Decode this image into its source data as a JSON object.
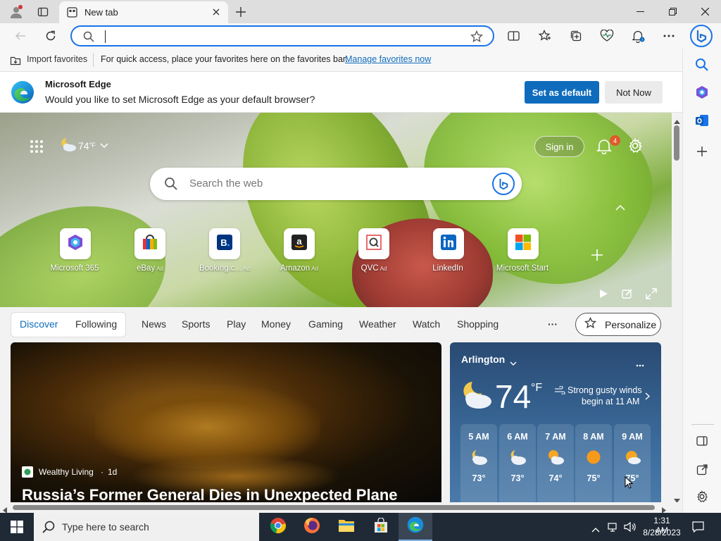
{
  "browser": {
    "tab_title": "New tab",
    "address_value": "",
    "favbar": {
      "import_label": "Import favorites",
      "message": "For quick access, place your favorites here on the favorites bar.",
      "link": "Manage favorites now"
    },
    "notice": {
      "title": "Microsoft Edge",
      "message": "Would you like to set Microsoft Edge as your default browser?",
      "primary_button": "Set as default",
      "secondary_button": "Not Now"
    }
  },
  "newtab": {
    "weather_temp": "74",
    "weather_unit": "°F",
    "sign_in": "Sign in",
    "notification_count": "4",
    "search_placeholder": "Search the web",
    "tiles": [
      {
        "label": "Microsoft 365",
        "ad": ""
      },
      {
        "label": "eBay",
        "ad": "Ad"
      },
      {
        "label": "Booking.c...",
        "ad": "Ad"
      },
      {
        "label": "Amazon",
        "ad": "Ad"
      },
      {
        "label": "QVC",
        "ad": "Ad"
      },
      {
        "label": "LinkedIn",
        "ad": ""
      },
      {
        "label": "Microsoft Start",
        "ad": ""
      }
    ]
  },
  "feed": {
    "nav": [
      "Discover",
      "Following",
      "News",
      "Sports",
      "Play",
      "Money",
      "Gaming",
      "Weather",
      "Watch",
      "Shopping"
    ],
    "more": "···",
    "personalize": "Personalize",
    "article": {
      "source": "Wealthy Living",
      "age": "1d",
      "headline": "Russia’s Former General Dies in Unexpected Plane"
    },
    "weather_card": {
      "location": "Arlington",
      "temp": "74",
      "unit": "°F",
      "alert_line1": "Strong gusty winds",
      "alert_line2": "begin at 11 AM",
      "hours": [
        {
          "time": "5 AM",
          "temp": "73°",
          "icon": "partly-cloudy-night-icon"
        },
        {
          "time": "6 AM",
          "temp": "73°",
          "icon": "partly-cloudy-night-icon"
        },
        {
          "time": "7 AM",
          "temp": "74°",
          "icon": "partly-cloudy-sun-icon"
        },
        {
          "time": "8 AM",
          "temp": "75°",
          "icon": "sun-icon"
        },
        {
          "time": "9 AM",
          "temp": "75°",
          "icon": "partly-cloudy-sun-icon"
        }
      ]
    }
  },
  "taskbar": {
    "search_placeholder": "Type here to search",
    "time": "1:31 AM",
    "date": "8/28/2023"
  },
  "colors": {
    "accent": "#0f6cbd",
    "address_focus": "#1a73e8",
    "taskbar": "#1f2a36"
  }
}
